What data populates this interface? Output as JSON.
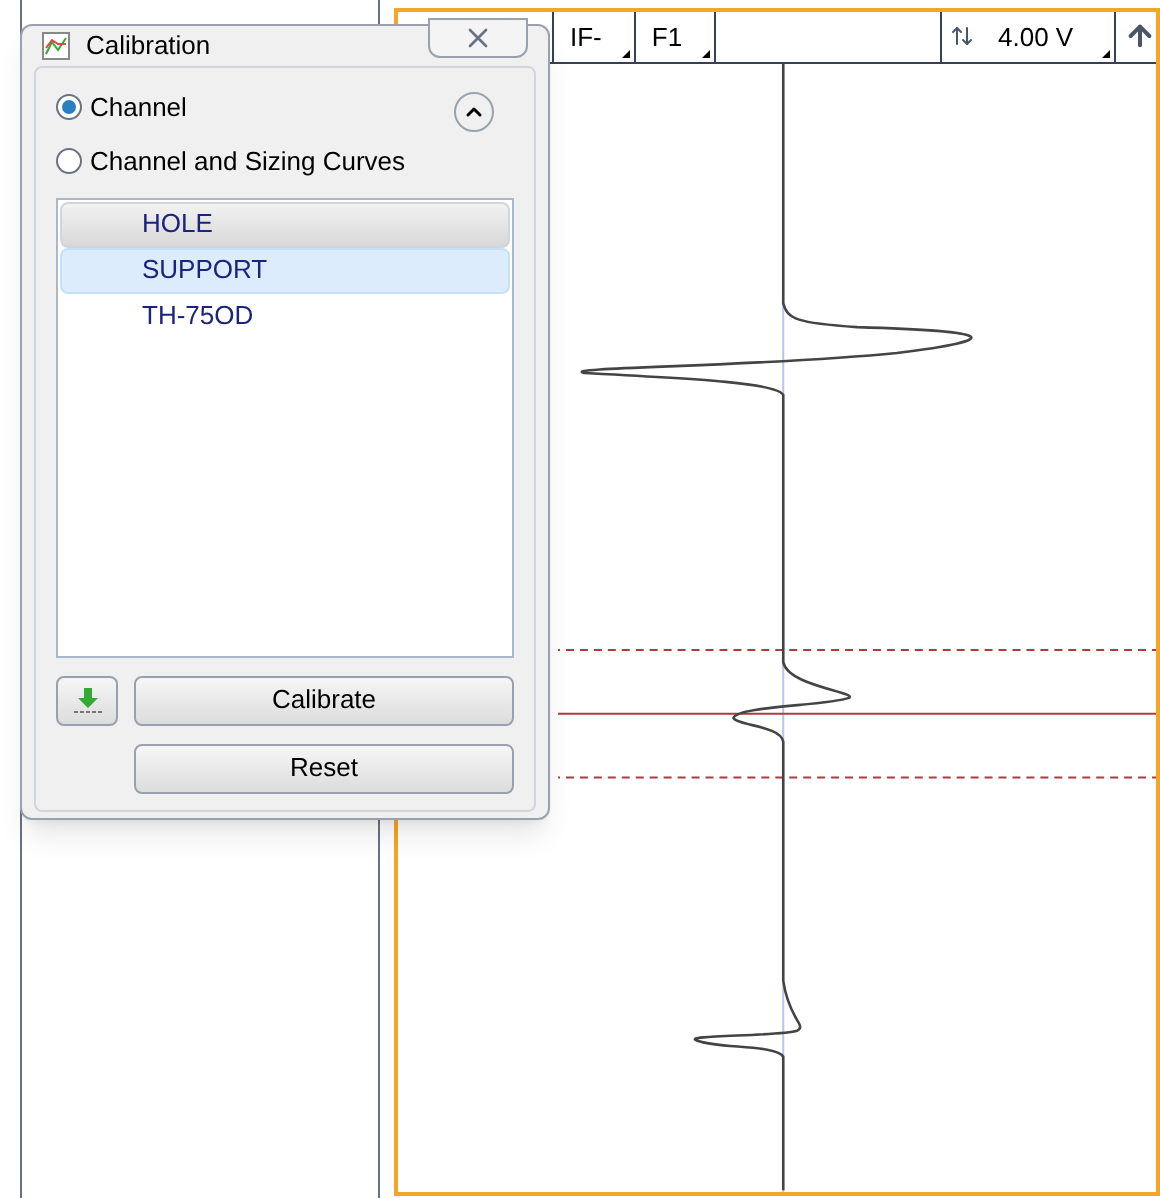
{
  "toolbar": {
    "dropdowns": [
      {
        "label": "IF-"
      },
      {
        "label": "F1"
      }
    ],
    "range": "4.00 V"
  },
  "dialog": {
    "title": "Calibration",
    "options": [
      {
        "label": "Channel",
        "selected": true
      },
      {
        "label": "Channel and Sizing Curves",
        "selected": false
      }
    ],
    "channels": [
      {
        "label": "HOLE",
        "selected": false,
        "highlighted": true
      },
      {
        "label": "SUPPORT",
        "selected": true,
        "highlighted": false
      },
      {
        "label": "TH-75OD",
        "selected": false,
        "highlighted": false
      }
    ],
    "buttons": [
      "Calibrate",
      "Reset"
    ]
  }
}
